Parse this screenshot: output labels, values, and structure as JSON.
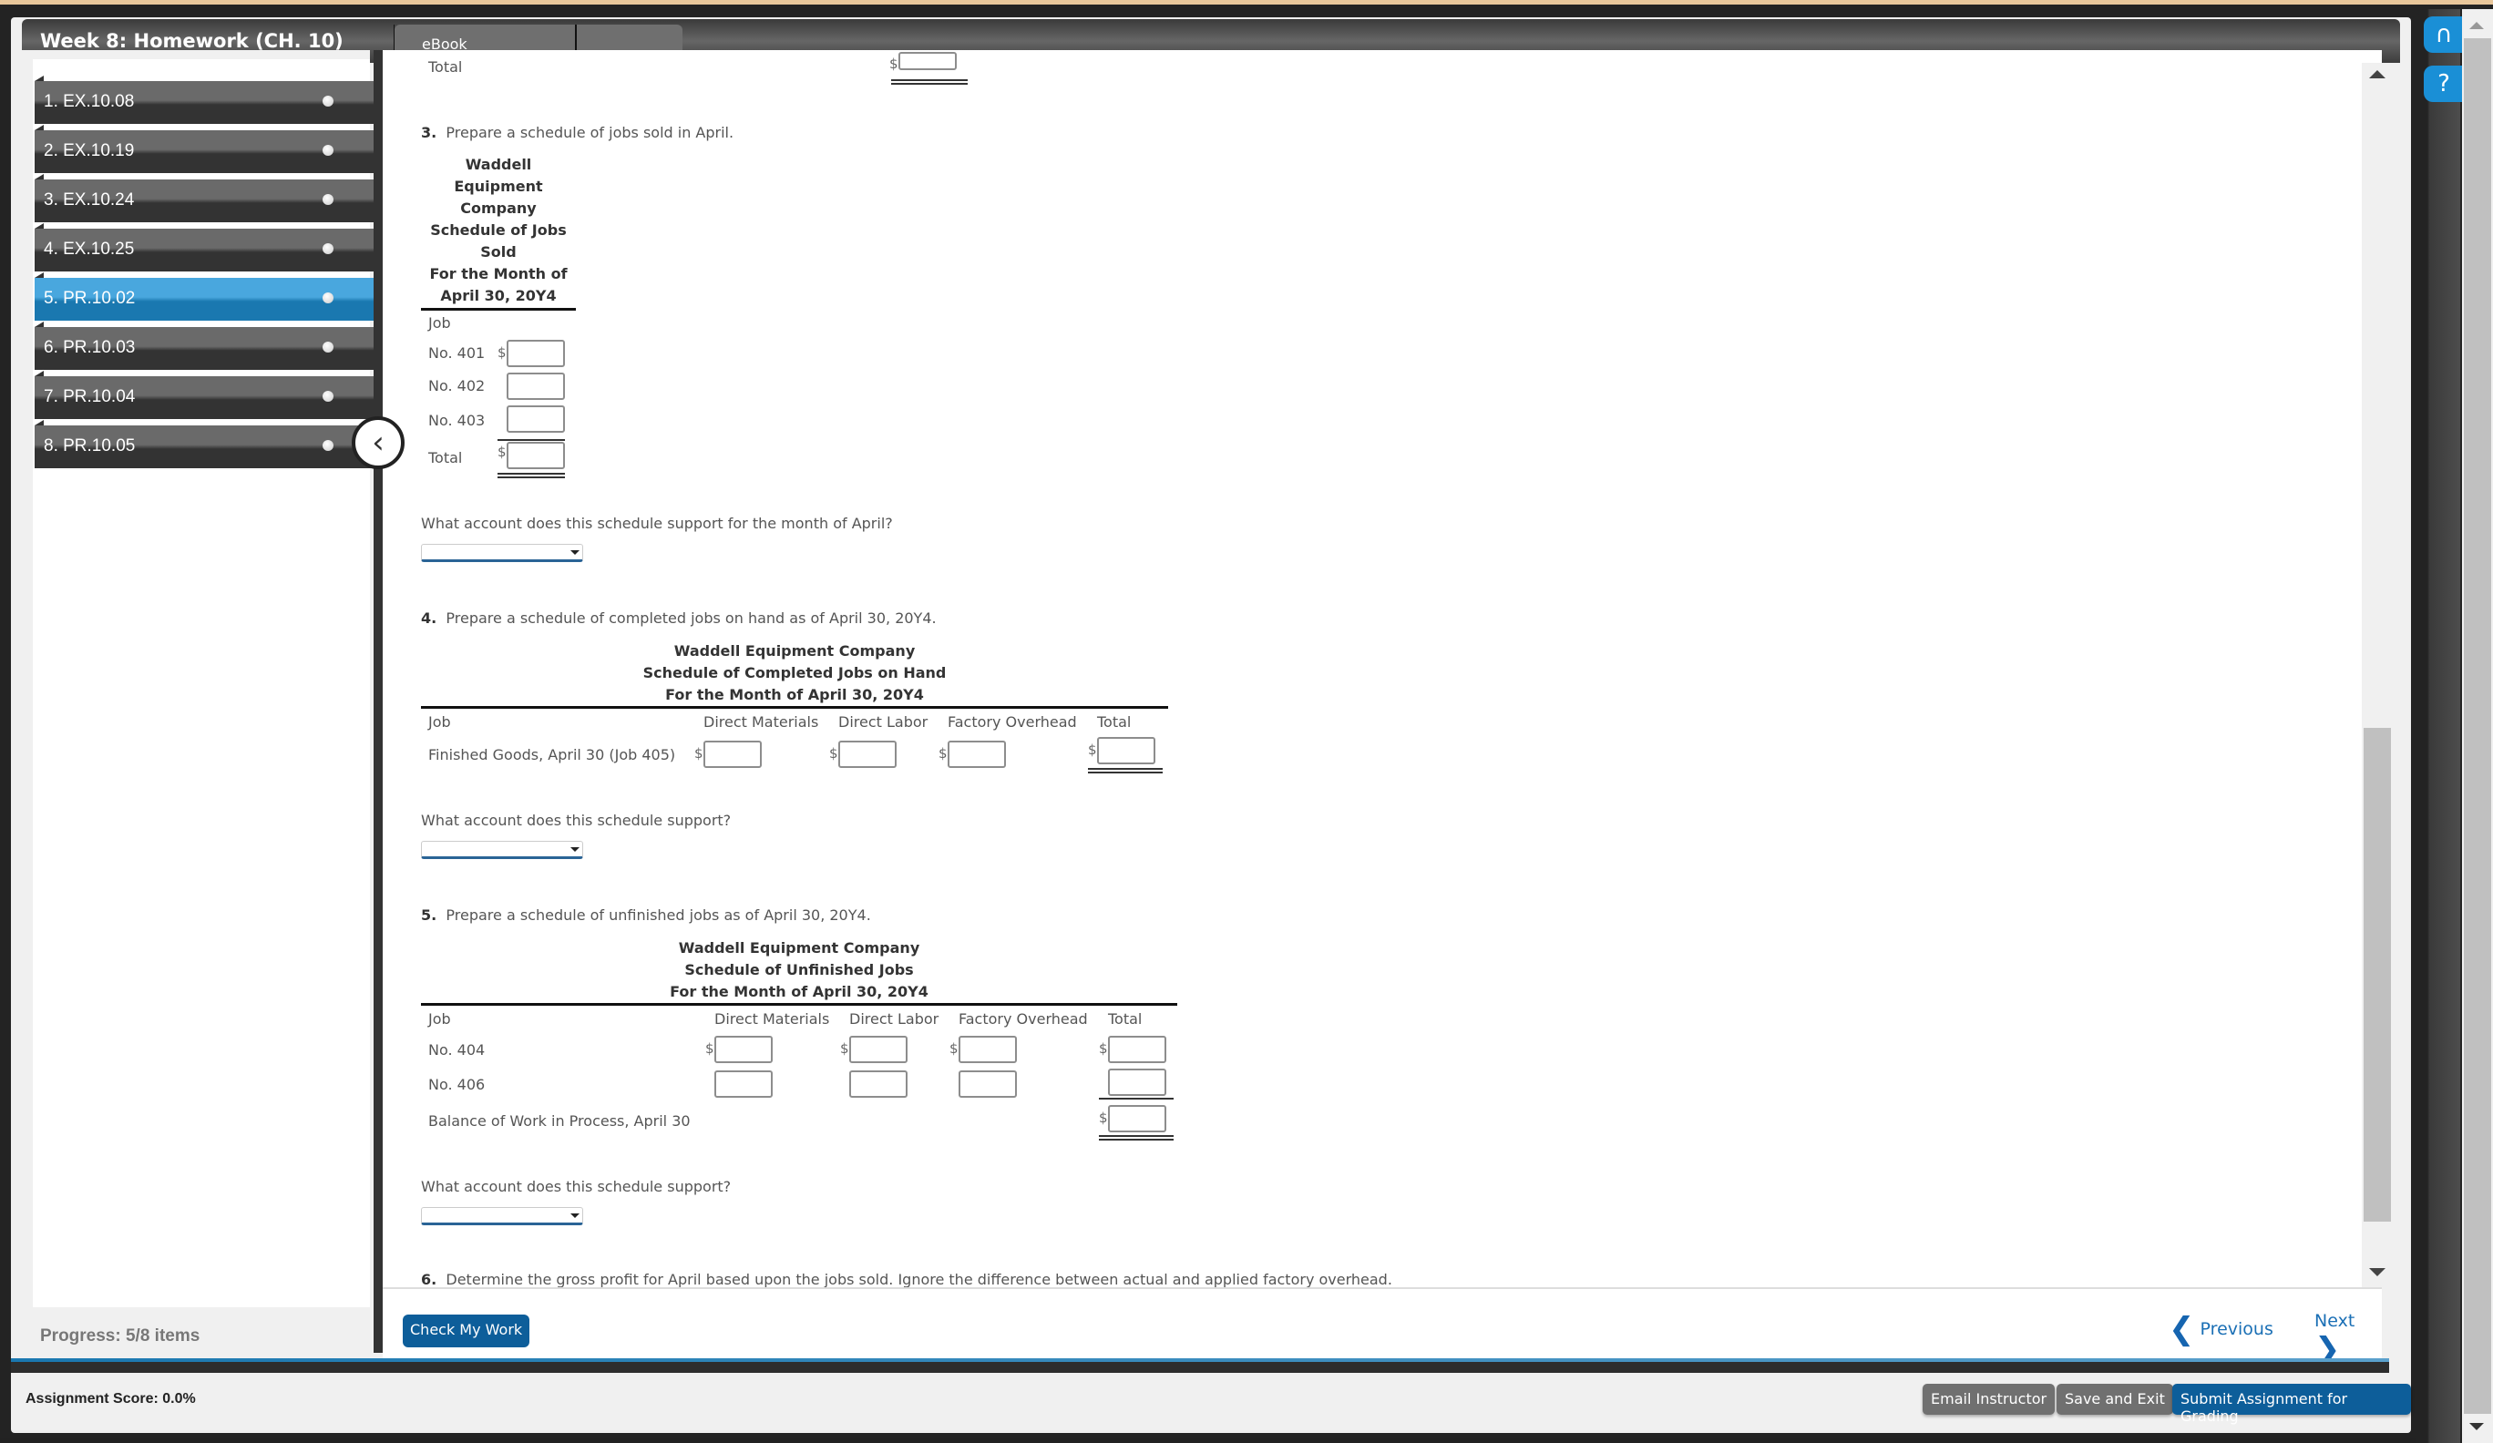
{
  "header": {
    "assignment_title": "Week 8: Homework (CH. 10)",
    "tabs": [
      {
        "label": "eBook"
      },
      {
        "label": ""
      }
    ]
  },
  "sidebar": {
    "items": [
      {
        "label": "1. EX.10.08",
        "active": false
      },
      {
        "label": "2. EX.10.19",
        "active": false
      },
      {
        "label": "3. EX.10.24",
        "active": false
      },
      {
        "label": "4. EX.10.25",
        "active": false
      },
      {
        "label": "5. PR.10.02",
        "active": true
      },
      {
        "label": "6. PR.10.03",
        "active": false
      },
      {
        "label": "7. PR.10.04",
        "active": false
      },
      {
        "label": "8. PR.10.05",
        "active": false
      }
    ],
    "progress": "Progress:  5/8 items"
  },
  "content": {
    "prev_total_label": "Total",
    "dollar": "$",
    "part3": {
      "number": "3.",
      "prompt": "Prepare a schedule of jobs sold in April.",
      "heading": [
        "Waddell",
        "Equipment",
        "Company",
        "Schedule of Jobs",
        "Sold",
        "For the Month of",
        "April 30, 20Y4"
      ],
      "col_job": "Job",
      "rows": [
        {
          "label": "No. 401",
          "value": ""
        },
        {
          "label": "No. 402",
          "value": ""
        },
        {
          "label": "No. 403",
          "value": ""
        }
      ],
      "total_label": "Total",
      "total_value": "",
      "question": "What account does this schedule support for the month of April?",
      "account_selected": ""
    },
    "part4": {
      "number": "4.",
      "prompt": "Prepare a schedule of completed jobs on hand as of April 30, 20Y4.",
      "heading": [
        "Waddell Equipment Company",
        "Schedule of Completed Jobs on Hand",
        "For the Month of April 30, 20Y4"
      ],
      "columns": [
        "Job",
        "Direct Materials",
        "Direct Labor",
        "Factory Overhead",
        "Total"
      ],
      "row_label": "Finished Goods, April 30 (Job 405)",
      "question": "What account does this schedule support?",
      "account_selected": ""
    },
    "part5": {
      "number": "5.",
      "prompt": "Prepare a schedule of unfinished jobs as of April 30, 20Y4.",
      "heading": [
        "Waddell Equipment Company",
        "Schedule of Unfinished Jobs",
        "For the Month of April 30, 20Y4"
      ],
      "columns": [
        "Job",
        "Direct Materials",
        "Direct Labor",
        "Factory Overhead",
        "Total"
      ],
      "rows": [
        {
          "label": "No. 404"
        },
        {
          "label": "No. 406"
        }
      ],
      "balance_label": "Balance of Work in Process, April 30",
      "question": "What account does this schedule support?",
      "account_selected": ""
    },
    "part6": {
      "number": "6.",
      "prompt": "Determine the gross profit for April based upon the jobs sold. Ignore the difference between actual and applied factory overhead."
    }
  },
  "bottom": {
    "check_label": "Check My Work",
    "previous_label": "Previous",
    "next_label": "Next"
  },
  "footer": {
    "score": "Assignment Score:   0.0%",
    "email_label": "Email Instructor",
    "save_label": "Save and Exit",
    "submit_label": "Submit Assignment for Grading"
  },
  "icons": {
    "support": "headset-icon",
    "help": "question-circle-icon"
  }
}
